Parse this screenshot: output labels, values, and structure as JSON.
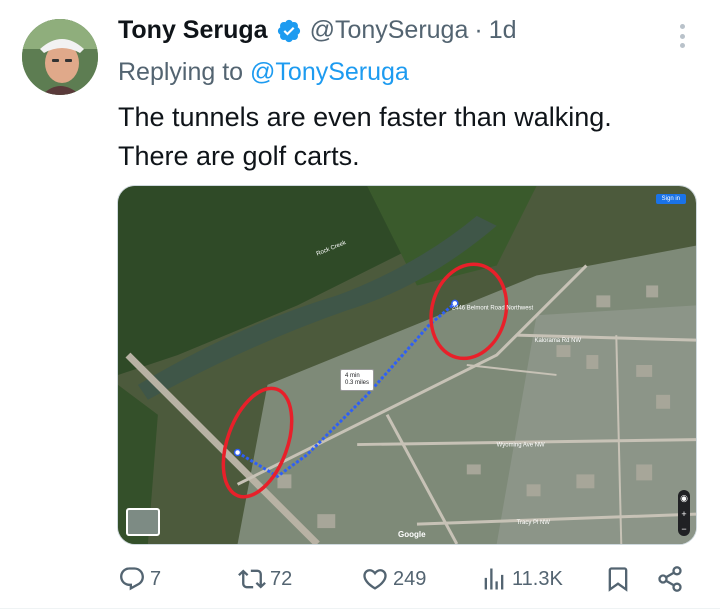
{
  "tweet": {
    "author_name": "Tony Seruga",
    "handle": "@TonySeruga",
    "separator": "·",
    "time": "1d",
    "replying_prefix": "Replying to",
    "replying_handle": "@TonySeruga",
    "text_lines": [
      "The tunnels are even faster than walking.",
      "There are golf carts."
    ]
  },
  "media": {
    "sign_in": "Sign in",
    "walk_time": "4 min",
    "walk_dist": "0.3 miles",
    "google": "Google",
    "labels": {
      "rock_creek": "Rock Creek",
      "kalorama": "Kalorama Rd NW",
      "wyoming": "Wyoming Ave NW",
      "tracy": "Tracy Pl NW",
      "belmont": "2446 Belmont Road Northwest"
    }
  },
  "actions": {
    "replies": "7",
    "reposts": "72",
    "likes": "249",
    "views": "11.3K"
  },
  "colors": {
    "link": "#1d9bf0",
    "muted": "#536471",
    "text": "#0f1419",
    "verified": "#1d9bf0",
    "annotation": "#e8202a",
    "route": "#2f5ff5"
  },
  "icons": [
    "avatar",
    "verified-badge-icon",
    "more-icon",
    "reply-icon",
    "repost-icon",
    "like-icon",
    "views-icon",
    "bookmark-icon",
    "share-icon"
  ]
}
